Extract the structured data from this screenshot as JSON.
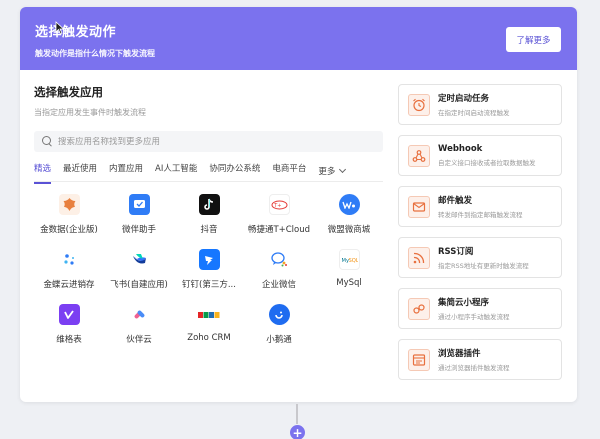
{
  "banner": {
    "title": "选择触发动作",
    "subtitle": "触发动作是指什么情况下触发流程",
    "learn_more": "了解更多"
  },
  "section": {
    "title": "选择触发应用",
    "subtitle": "当指定应用发生事件时触发流程"
  },
  "search": {
    "placeholder": "搜索应用名称找到更多应用"
  },
  "tabs": [
    {
      "label": "精选",
      "active": true
    },
    {
      "label": "最近使用"
    },
    {
      "label": "内置应用"
    },
    {
      "label": "AI人工智能"
    },
    {
      "label": "协同办公系统"
    },
    {
      "label": "电商平台"
    },
    {
      "label": "更多"
    }
  ],
  "apps": [
    {
      "label": "金数据(企业版)",
      "icon": "jinshuju-icon"
    },
    {
      "label": "微伴助手",
      "icon": "weiban-icon"
    },
    {
      "label": "抖音",
      "icon": "douyin-icon"
    },
    {
      "label": "畅捷通T+Cloud",
      "icon": "chanjet-icon"
    },
    {
      "label": "微盟微商城",
      "icon": "weimob-icon"
    },
    {
      "label": "金蝶云进销存",
      "icon": "kingdee-icon"
    },
    {
      "label": "飞书(自建应用)",
      "icon": "feishu-icon"
    },
    {
      "label": "钉钉(第三方...",
      "icon": "dingtalk-icon"
    },
    {
      "label": "企业微信",
      "icon": "wecom-icon"
    },
    {
      "label": "MySql",
      "icon": "mysql-icon"
    },
    {
      "label": "维格表",
      "icon": "vika-icon"
    },
    {
      "label": "伙伴云",
      "icon": "huoban-icon"
    },
    {
      "label": "Zoho CRM",
      "icon": "zoho-icon"
    },
    {
      "label": "小鹅通",
      "icon": "xiaoe-icon"
    }
  ],
  "triggers": [
    {
      "title": "定时启动任务",
      "desc": "在指定时间启动流程触发",
      "icon": "alarm-clock-icon"
    },
    {
      "title": "Webhook",
      "desc": "自定义接口接收或者拉取数据触发",
      "icon": "webhook-icon"
    },
    {
      "title": "邮件触发",
      "desc": "转发邮件到指定邮箱触发流程",
      "icon": "mail-icon"
    },
    {
      "title": "RSS订阅",
      "desc": "指定RSS地址有更新时触发流程",
      "icon": "rss-icon"
    },
    {
      "title": "集简云小程序",
      "desc": "通过小程序手动触发流程",
      "icon": "mini-program-icon"
    },
    {
      "title": "浏览器插件",
      "desc": "通过浏览器插件触发流程",
      "icon": "browser-plugin-icon"
    }
  ],
  "colors": {
    "accent": "#7b72ee",
    "accent_text": "#5a52d5",
    "trigger_icon": "#e8703f"
  },
  "add_button": "+"
}
